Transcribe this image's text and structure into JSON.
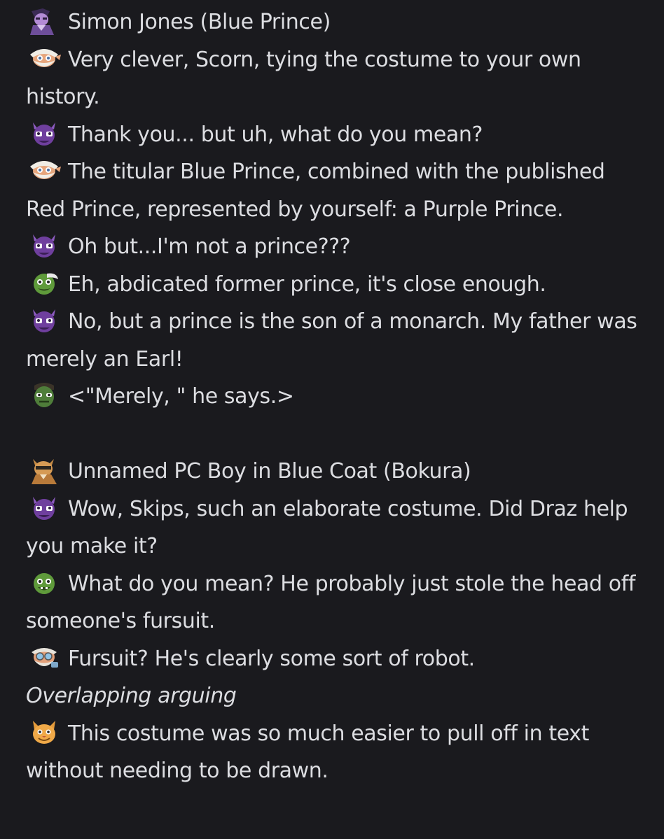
{
  "scenes": [
    {
      "header": "Simon Jones (Blue Prince)",
      "header_icon": "purple-character-avatar-icon",
      "lines": [
        {
          "icon": "bearded-old-man-icon",
          "text": "Very clever, Scorn, tying the costume to your own history."
        },
        {
          "icon": "purple-demon-face-icon",
          "text": "Thank you... but uh, what do you mean?"
        },
        {
          "icon": "bearded-old-man-icon",
          "text": "The titular Blue Prince, combined with the published Red Prince, represented by yourself: a Purple Prince."
        },
        {
          "icon": "purple-demon-face-icon",
          "text": "Oh but...I'm not a prince???"
        },
        {
          "icon": "green-goblin-face-icon",
          "text": "Eh, abdicated former prince, it's close enough."
        },
        {
          "icon": "purple-demon-face-icon",
          "text": "No, but a prince is the son of a monarch. My father was merely an Earl!"
        },
        {
          "icon": "green-orc-face-icon",
          "text": "<\"Merely, \" he says.>"
        }
      ]
    },
    {
      "header": "Unnamed PC Boy in Blue Coat (Bokura)",
      "header_icon": "cat-character-avatar-icon",
      "lines": [
        {
          "icon": "purple-demon-face-icon",
          "text": "Wow, Skips, such an elaborate costume. Did Draz help you make it?"
        },
        {
          "icon": "green-goblin-face-icon",
          "text": "What do you mean? He probably just stole the head off someone's fursuit."
        },
        {
          "icon": "bearded-goggles-man-icon",
          "text": "Fursuit? He's clearly some sort of robot."
        },
        {
          "stage_direction": "Overlapping arguing"
        },
        {
          "icon": "orange-cat-face-icon",
          "text": "This costume was so much easier to pull off in text without needing to be drawn."
        }
      ]
    }
  ]
}
